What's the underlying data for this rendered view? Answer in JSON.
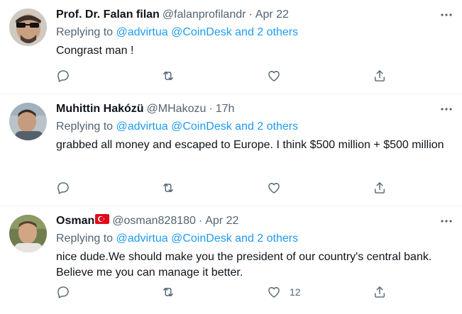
{
  "tweets": [
    {
      "name": "Prof. Dr. Falan filan",
      "handle": "@falanprofilandr",
      "sep": "·",
      "time": "Apr 22",
      "replying_prefix": "Replying to",
      "replying_links": "@advirtua @CoinDesk and 2 others",
      "text": "Congrast man !",
      "likes": ""
    },
    {
      "name": "Muhittin Hakózü",
      "handle": "@MHakozu",
      "sep": "·",
      "time": "17h",
      "replying_prefix": "Replying to",
      "replying_links": "@advirtua @CoinDesk and 2 others",
      "text": "grabbed all money and escaped to Europe. I think $500 million + $500 million",
      "likes": ""
    },
    {
      "name": "Osman",
      "handle": "@osman828180",
      "sep": "·",
      "time": "Apr 22",
      "replying_prefix": "Replying to",
      "replying_links": "@advirtua @CoinDesk and 2 others",
      "text": "nice dude.We should make you the president of our country's central bank. Believe me you can manage it better.",
      "likes": "12"
    }
  ],
  "colors": {
    "text": "#0f1419",
    "secondary": "#536471",
    "link": "#1d9bf0",
    "divider": "#eff3f4",
    "flag": "#e30a17"
  },
  "icons": [
    "more-icon",
    "reply-icon",
    "retweet-icon",
    "like-icon",
    "share-icon",
    "turkey-flag-icon"
  ]
}
